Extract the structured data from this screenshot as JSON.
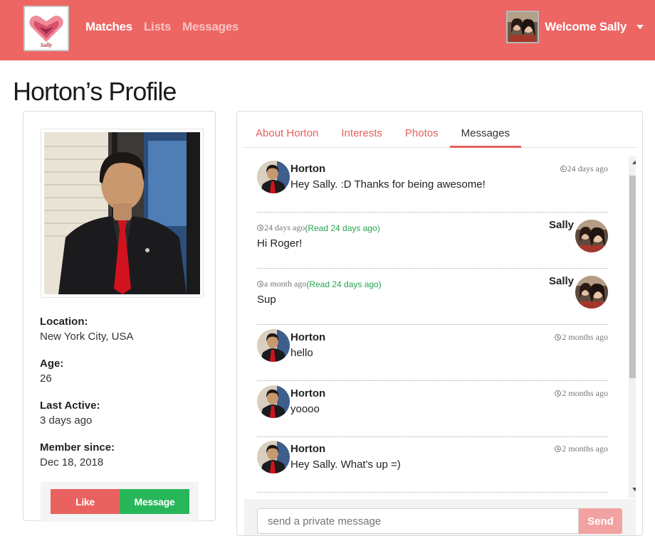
{
  "nav": {
    "logo_text": "Sally",
    "links": [
      {
        "label": "Matches",
        "active": true
      },
      {
        "label": "Lists",
        "active": false
      },
      {
        "label": "Messages",
        "active": false
      }
    ],
    "welcome": "Welcome Sally"
  },
  "page": {
    "title": "Horton’s Profile"
  },
  "profile": {
    "location_label": "Location:",
    "location": "New York City, USA",
    "age_label": "Age:",
    "age": "26",
    "last_active_label": "Last Active:",
    "last_active": "3 days ago",
    "member_since_label": "Member since:",
    "member_since": "Dec 18, 2018",
    "like_label": "Like",
    "message_label": "Message"
  },
  "tabs": [
    {
      "label": "About Horton",
      "active": false
    },
    {
      "label": "Interests",
      "active": false
    },
    {
      "label": "Photos",
      "active": false
    },
    {
      "label": "Messages",
      "active": true
    }
  ],
  "messages": [
    {
      "side": "left",
      "sender": "Horton",
      "time": "24 days ago",
      "read": "",
      "text": "Hey Sally. :D Thanks for being awesome!"
    },
    {
      "side": "right",
      "sender": "Sally",
      "time": "24 days ago",
      "read": "(Read 24 days ago)",
      "text": "Hi Roger!"
    },
    {
      "side": "right",
      "sender": "Sally",
      "time": "a month ago",
      "read": "(Read 24 days ago)",
      "text": "Sup"
    },
    {
      "side": "left",
      "sender": "Horton",
      "time": "2 months ago",
      "read": "",
      "text": "hello"
    },
    {
      "side": "left",
      "sender": "Horton",
      "time": "2 months ago",
      "read": "",
      "text": "yoooo"
    },
    {
      "side": "left",
      "sender": "Horton",
      "time": "2 months ago",
      "read": "",
      "text": "Hey Sally. What's up =)"
    }
  ],
  "compose": {
    "placeholder": "send a private message",
    "send_label": "Send"
  },
  "colors": {
    "brand": "#ed6663",
    "like": "#e9625f",
    "message": "#27b65a",
    "read": "#27a34f",
    "send": "#f2a3a1"
  }
}
